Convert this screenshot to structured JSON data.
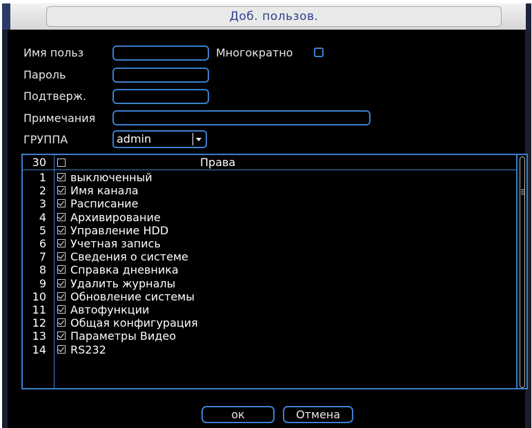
{
  "window": {
    "title": "Доб. пользов."
  },
  "form": {
    "username_label": "Имя польз",
    "username_value": "",
    "multiple_label": "Многократно",
    "multiple_checked": false,
    "password_label": "Пароль",
    "password_value": "",
    "confirm_label": "Подтверж.",
    "confirm_value": "",
    "notes_label": "Примечания",
    "notes_value": "",
    "group_label": "ГРУППА",
    "group_selected": "admin"
  },
  "rights": {
    "count": "30",
    "header_label": "Права",
    "header_checked": false,
    "items": [
      {
        "num": "1",
        "label": "выключенный",
        "checked": true
      },
      {
        "num": "2",
        "label": "Имя канала",
        "checked": true
      },
      {
        "num": "3",
        "label": "Расписание",
        "checked": true
      },
      {
        "num": "4",
        "label": "Архивирование",
        "checked": true
      },
      {
        "num": "5",
        "label": "Управление HDD",
        "checked": true
      },
      {
        "num": "6",
        "label": "Учетная запись",
        "checked": true
      },
      {
        "num": "7",
        "label": "Сведения о системе",
        "checked": true
      },
      {
        "num": "8",
        "label": "Справка дневника",
        "checked": true
      },
      {
        "num": "9",
        "label": "Удалить журналы",
        "checked": true
      },
      {
        "num": "10",
        "label": "Обновление системы",
        "checked": true
      },
      {
        "num": "11",
        "label": "Автофункции",
        "checked": true
      },
      {
        "num": "12",
        "label": "Общая конфигурация",
        "checked": true
      },
      {
        "num": "13",
        "label": "Параметры Видео",
        "checked": true
      },
      {
        "num": "14",
        "label": "RS232",
        "checked": true
      }
    ]
  },
  "buttons": {
    "ok_label": "ок",
    "cancel_label": "Отмена"
  },
  "colors": {
    "accent": "#3a80d0",
    "title_text": "#2b3f8c",
    "background": "#000000"
  }
}
